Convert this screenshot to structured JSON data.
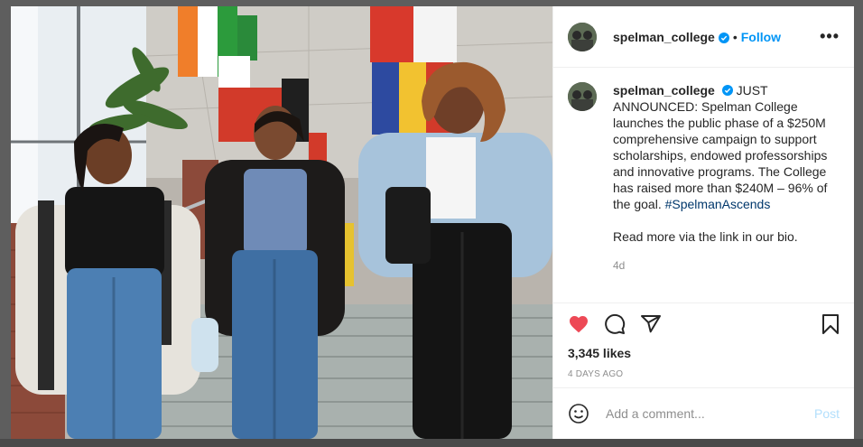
{
  "post": {
    "username": "spelman_college",
    "follow_label": "Follow",
    "separator": "•",
    "more_glyph": "•••",
    "caption": "JUST ANNOUNCED: Spelman College launches the public phase of a $250M comprehensive campaign to support scholarships, endowed professorships and innovative programs. The College has raised more than $240M – 96% of the goal.",
    "hashtag": "#SpelmanAscends",
    "caption_line2": "Read more via the link in our bio.",
    "age": "4d",
    "likes": "3,345 likes",
    "timestamp": "4 DAYS AGO"
  },
  "comment": {
    "placeholder": "Add a comment...",
    "post_label": "Post"
  },
  "icons": {
    "verified": "verified-badge-icon",
    "like": "heart-icon",
    "comment": "comment-icon",
    "share": "share-icon",
    "save": "bookmark-icon",
    "emoji": "emoji-icon",
    "more": "more-options-icon"
  },
  "colors": {
    "accent": "#0095f6",
    "liked": "#ed4956",
    "hashtag": "#00376b",
    "muted": "#8e8e8e"
  }
}
